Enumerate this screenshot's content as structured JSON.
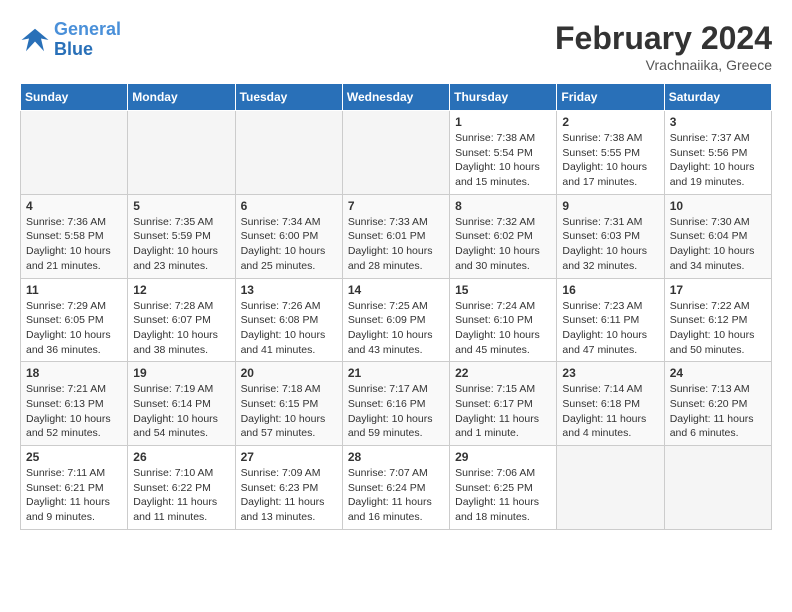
{
  "header": {
    "logo_line1": "General",
    "logo_line2": "Blue",
    "title": "February 2024",
    "subtitle": "Vrachnaiika, Greece"
  },
  "days_of_week": [
    "Sunday",
    "Monday",
    "Tuesday",
    "Wednesday",
    "Thursday",
    "Friday",
    "Saturday"
  ],
  "weeks": [
    [
      {
        "day": "",
        "info": ""
      },
      {
        "day": "",
        "info": ""
      },
      {
        "day": "",
        "info": ""
      },
      {
        "day": "",
        "info": ""
      },
      {
        "day": "1",
        "info": "Sunrise: 7:38 AM\nSunset: 5:54 PM\nDaylight: 10 hours and 15 minutes."
      },
      {
        "day": "2",
        "info": "Sunrise: 7:38 AM\nSunset: 5:55 PM\nDaylight: 10 hours and 17 minutes."
      },
      {
        "day": "3",
        "info": "Sunrise: 7:37 AM\nSunset: 5:56 PM\nDaylight: 10 hours and 19 minutes."
      }
    ],
    [
      {
        "day": "4",
        "info": "Sunrise: 7:36 AM\nSunset: 5:58 PM\nDaylight: 10 hours and 21 minutes."
      },
      {
        "day": "5",
        "info": "Sunrise: 7:35 AM\nSunset: 5:59 PM\nDaylight: 10 hours and 23 minutes."
      },
      {
        "day": "6",
        "info": "Sunrise: 7:34 AM\nSunset: 6:00 PM\nDaylight: 10 hours and 25 minutes."
      },
      {
        "day": "7",
        "info": "Sunrise: 7:33 AM\nSunset: 6:01 PM\nDaylight: 10 hours and 28 minutes."
      },
      {
        "day": "8",
        "info": "Sunrise: 7:32 AM\nSunset: 6:02 PM\nDaylight: 10 hours and 30 minutes."
      },
      {
        "day": "9",
        "info": "Sunrise: 7:31 AM\nSunset: 6:03 PM\nDaylight: 10 hours and 32 minutes."
      },
      {
        "day": "10",
        "info": "Sunrise: 7:30 AM\nSunset: 6:04 PM\nDaylight: 10 hours and 34 minutes."
      }
    ],
    [
      {
        "day": "11",
        "info": "Sunrise: 7:29 AM\nSunset: 6:05 PM\nDaylight: 10 hours and 36 minutes."
      },
      {
        "day": "12",
        "info": "Sunrise: 7:28 AM\nSunset: 6:07 PM\nDaylight: 10 hours and 38 minutes."
      },
      {
        "day": "13",
        "info": "Sunrise: 7:26 AM\nSunset: 6:08 PM\nDaylight: 10 hours and 41 minutes."
      },
      {
        "day": "14",
        "info": "Sunrise: 7:25 AM\nSunset: 6:09 PM\nDaylight: 10 hours and 43 minutes."
      },
      {
        "day": "15",
        "info": "Sunrise: 7:24 AM\nSunset: 6:10 PM\nDaylight: 10 hours and 45 minutes."
      },
      {
        "day": "16",
        "info": "Sunrise: 7:23 AM\nSunset: 6:11 PM\nDaylight: 10 hours and 47 minutes."
      },
      {
        "day": "17",
        "info": "Sunrise: 7:22 AM\nSunset: 6:12 PM\nDaylight: 10 hours and 50 minutes."
      }
    ],
    [
      {
        "day": "18",
        "info": "Sunrise: 7:21 AM\nSunset: 6:13 PM\nDaylight: 10 hours and 52 minutes."
      },
      {
        "day": "19",
        "info": "Sunrise: 7:19 AM\nSunset: 6:14 PM\nDaylight: 10 hours and 54 minutes."
      },
      {
        "day": "20",
        "info": "Sunrise: 7:18 AM\nSunset: 6:15 PM\nDaylight: 10 hours and 57 minutes."
      },
      {
        "day": "21",
        "info": "Sunrise: 7:17 AM\nSunset: 6:16 PM\nDaylight: 10 hours and 59 minutes."
      },
      {
        "day": "22",
        "info": "Sunrise: 7:15 AM\nSunset: 6:17 PM\nDaylight: 11 hours and 1 minute."
      },
      {
        "day": "23",
        "info": "Sunrise: 7:14 AM\nSunset: 6:18 PM\nDaylight: 11 hours and 4 minutes."
      },
      {
        "day": "24",
        "info": "Sunrise: 7:13 AM\nSunset: 6:20 PM\nDaylight: 11 hours and 6 minutes."
      }
    ],
    [
      {
        "day": "25",
        "info": "Sunrise: 7:11 AM\nSunset: 6:21 PM\nDaylight: 11 hours and 9 minutes."
      },
      {
        "day": "26",
        "info": "Sunrise: 7:10 AM\nSunset: 6:22 PM\nDaylight: 11 hours and 11 minutes."
      },
      {
        "day": "27",
        "info": "Sunrise: 7:09 AM\nSunset: 6:23 PM\nDaylight: 11 hours and 13 minutes."
      },
      {
        "day": "28",
        "info": "Sunrise: 7:07 AM\nSunset: 6:24 PM\nDaylight: 11 hours and 16 minutes."
      },
      {
        "day": "29",
        "info": "Sunrise: 7:06 AM\nSunset: 6:25 PM\nDaylight: 11 hours and 18 minutes."
      },
      {
        "day": "",
        "info": ""
      },
      {
        "day": "",
        "info": ""
      }
    ]
  ]
}
